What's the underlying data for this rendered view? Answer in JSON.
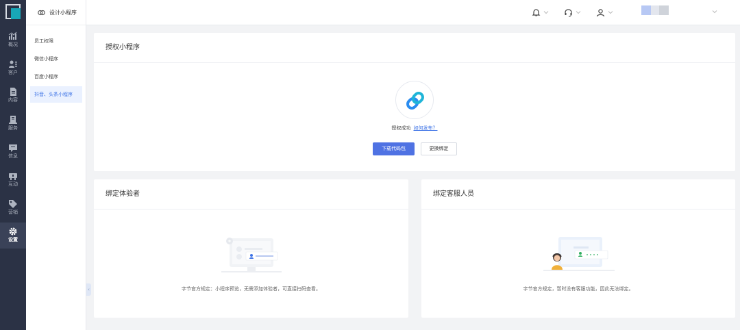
{
  "rail": {
    "items": [
      {
        "label": "概况",
        "icon": "chart-icon"
      },
      {
        "label": "客户",
        "icon": "customers-icon"
      },
      {
        "label": "内容",
        "icon": "document-icon"
      },
      {
        "label": "服务",
        "icon": "service-icon"
      },
      {
        "label": "信息",
        "icon": "message-icon"
      },
      {
        "label": "互动",
        "icon": "interaction-icon"
      },
      {
        "label": "营销",
        "icon": "tag-icon"
      },
      {
        "label": "设置",
        "icon": "gear-icon",
        "active": true
      }
    ]
  },
  "subnav": {
    "title": "设计小程序",
    "items": [
      {
        "label": "员工权限"
      },
      {
        "label": "微信小程序"
      },
      {
        "label": "百度小程序"
      },
      {
        "label": "抖音、头条小程序",
        "active": true
      }
    ]
  },
  "topbar": {
    "icons": [
      "bell-icon",
      "headset-icon",
      "user-icon"
    ]
  },
  "auth": {
    "title": "授权小程序",
    "status": "授权成功",
    "how_link": "如何发布？",
    "download_button": "下载代码包",
    "rebind_button": "更换绑定"
  },
  "testers": {
    "title": "绑定体验者",
    "empty_text": "字节官方规定：小程序预览，无需添加体验者，可直接扫码查看。"
  },
  "service": {
    "title": "绑定客服人员",
    "empty_text": "字节官方规定，暂时没有客服功能，因此无法绑定。"
  },
  "colors": {
    "primary": "#4f72e3",
    "rail_bg": "#2b3245",
    "link": "#3d73e6",
    "brand_teal": "#18a7b8"
  }
}
